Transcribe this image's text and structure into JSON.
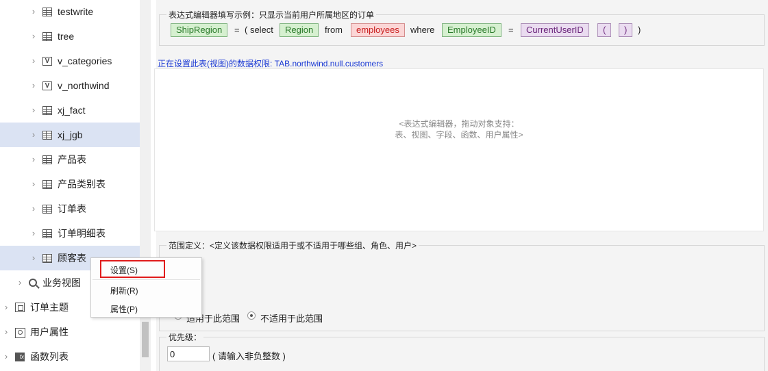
{
  "sidebar": {
    "items": [
      {
        "label": "testwrite",
        "icon": "table-icon"
      },
      {
        "label": "tree",
        "icon": "table-icon"
      },
      {
        "label": "v_categories",
        "icon": "view-icon"
      },
      {
        "label": "v_northwind",
        "icon": "view-icon"
      },
      {
        "label": "xj_fact",
        "icon": "table-icon"
      },
      {
        "label": "xj_jgb",
        "icon": "table-icon",
        "selected": true
      },
      {
        "label": "产品表",
        "icon": "table-icon"
      },
      {
        "label": "产品类别表",
        "icon": "table-icon"
      },
      {
        "label": "订单表",
        "icon": "table-icon"
      },
      {
        "label": "订单明细表",
        "icon": "table-icon"
      },
      {
        "label": "顾客表",
        "icon": "table-icon",
        "selected": true
      },
      {
        "label": "业务视图",
        "icon": "search-icon"
      },
      {
        "label": "订单主题",
        "icon": "topic-icon"
      },
      {
        "label": "用户属性",
        "icon": "user-icon"
      },
      {
        "label": "函数列表",
        "icon": "function-icon"
      }
    ]
  },
  "example": {
    "legend": "表达式编辑器填写示例：只显示当前用户所属地区的订单",
    "tokens": [
      "ShipRegion",
      "=",
      "( select",
      "Region",
      "from",
      "employees",
      "where",
      "EmployeeID",
      "=",
      "CurrentUserID",
      "(",
      ")",
      ")"
    ]
  },
  "editor": {
    "table_note": "正在设置此表(视图)的数据权限: TAB.northwind.null.customers",
    "hint": "<表达式编辑器，拖动对象支持：\n表、视图、字段、函数、用户属性>"
  },
  "scope": {
    "legend": "范围定义：<定义该数据权限适用于或不适用于哪些组、角色、用户>",
    "option_apply": "适用于此范围",
    "option_not_apply": "不适用于此范围",
    "selected": "option_not_apply"
  },
  "priority": {
    "legend": "优先级：",
    "value": "0",
    "hint": "( 请输入非负整数 )"
  },
  "context_menu": {
    "items": [
      "设置(S)",
      "刷新(R)",
      "属性(P)"
    ]
  },
  "colors": {
    "selected_row": "#dbe3f3",
    "token_green": "#d6f0d0",
    "token_red": "#fbd6d6",
    "token_purple": "#eadcf0",
    "highlight_border": "#e01b1b",
    "note_blue": "#1a39d4"
  }
}
